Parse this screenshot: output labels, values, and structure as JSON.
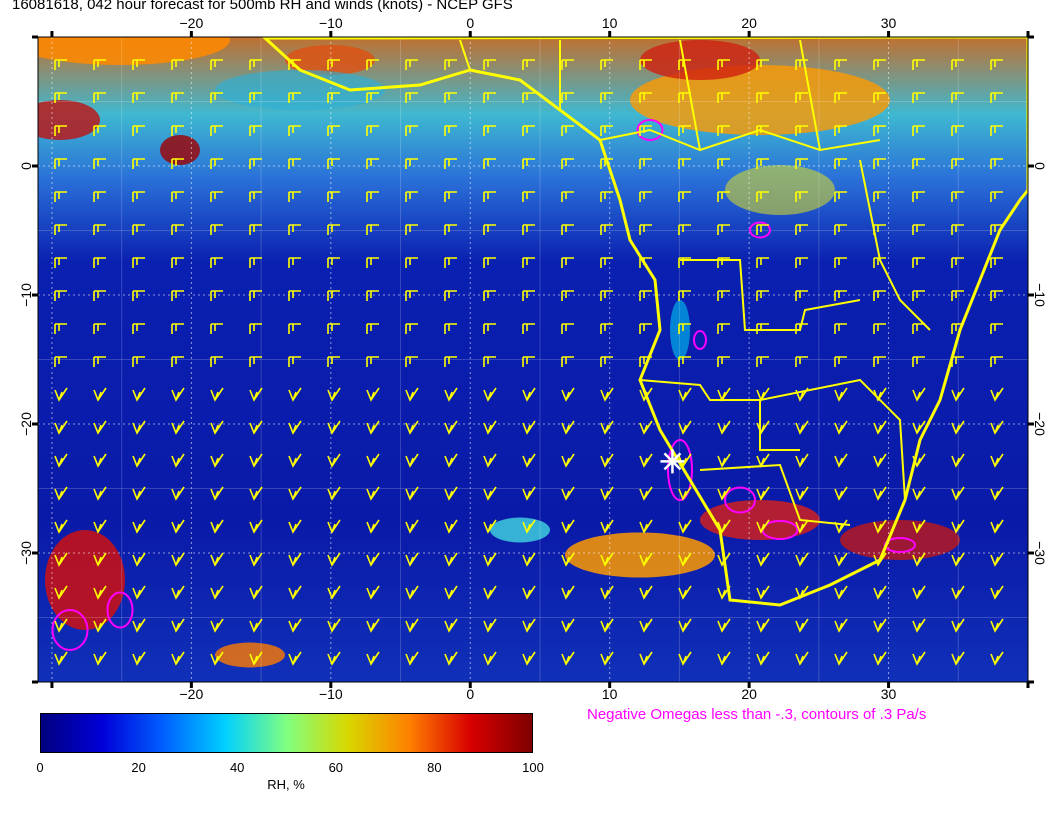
{
  "title": "16081618, 042 hour forecast for 500mb RH and winds (knots) - NCEP GFS",
  "map": {
    "lon_range": [
      -31,
      40
    ],
    "lat_range": [
      -40,
      10
    ],
    "lon_ticks": [
      -20,
      -10,
      0,
      10,
      20,
      30
    ],
    "lat_ticks": [
      0,
      -10,
      -20,
      -30
    ],
    "overlay_color": "#ffff00",
    "omega_color": "#ff00ff",
    "marker_color": "#ffffff",
    "marker_position": {
      "lon": 14.5,
      "lat": -22.9
    }
  },
  "note": "Negative Omegas less than -.3, contours of .3 Pa/s",
  "colorbar": {
    "label": "RH, %",
    "ticks": [
      "0",
      "20",
      "40",
      "60",
      "80",
      "100"
    ],
    "colors": [
      "#00007f",
      "#0000d8",
      "#0060ff",
      "#00d0ff",
      "#80ff80",
      "#d8d800",
      "#ff8000",
      "#d80000",
      "#7f0000"
    ]
  }
}
